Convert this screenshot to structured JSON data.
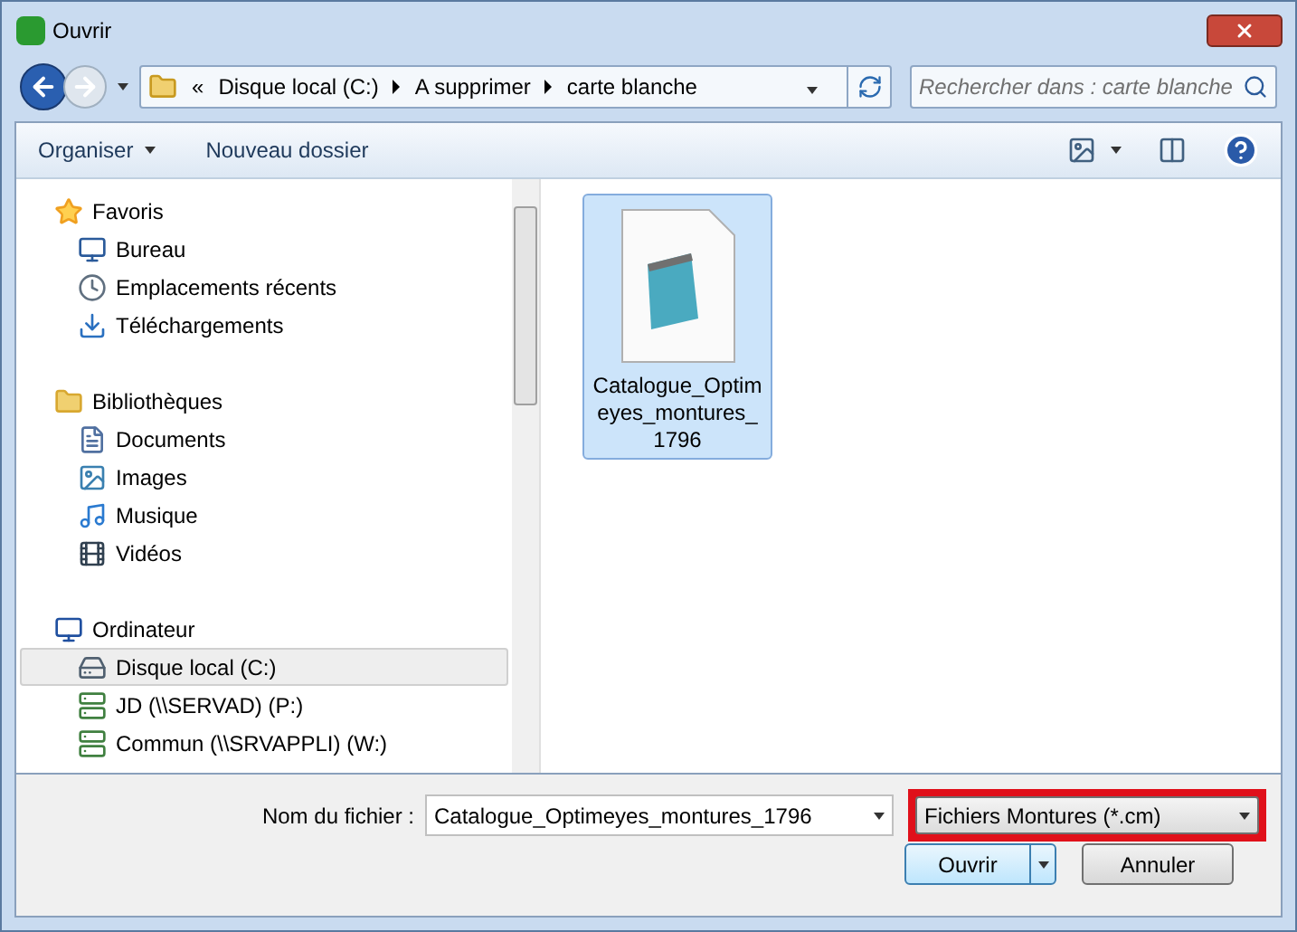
{
  "window": {
    "title": "Ouvrir"
  },
  "address_bar": {
    "overflow": "«",
    "segments": [
      "Disque local (C:)",
      "A supprimer",
      "carte blanche"
    ]
  },
  "search": {
    "placeholder": "Rechercher dans : carte blanche"
  },
  "toolbar": {
    "organize": "Organiser",
    "new_folder": "Nouveau dossier"
  },
  "sidebar": {
    "groups": [
      {
        "label": "Favoris",
        "children": [
          {
            "label": "Bureau",
            "selected": false
          },
          {
            "label": "Emplacements récents",
            "selected": false
          },
          {
            "label": "Téléchargements",
            "selected": false
          }
        ]
      },
      {
        "label": "Bibliothèques",
        "children": [
          {
            "label": "Documents",
            "selected": false
          },
          {
            "label": "Images",
            "selected": false
          },
          {
            "label": "Musique",
            "selected": false
          },
          {
            "label": "Vidéos",
            "selected": false
          }
        ]
      },
      {
        "label": "Ordinateur",
        "children": [
          {
            "label": "Disque local (C:)",
            "selected": true
          },
          {
            "label": "JD (\\\\SERVAD) (P:)",
            "selected": false
          },
          {
            "label": "Commun (\\\\SRVAPPLI) (W:)",
            "selected": false
          }
        ]
      }
    ]
  },
  "files": [
    {
      "name": "Catalogue_Optimeyes_montures_1796",
      "selected": true
    }
  ],
  "file_name": {
    "label": "Nom du fichier :",
    "value": "Catalogue_Optimeyes_montures_1796"
  },
  "file_type": {
    "value": "Fichiers Montures (*.cm)",
    "highlighted": true
  },
  "buttons": {
    "open": "Ouvrir",
    "cancel": "Annuler"
  }
}
